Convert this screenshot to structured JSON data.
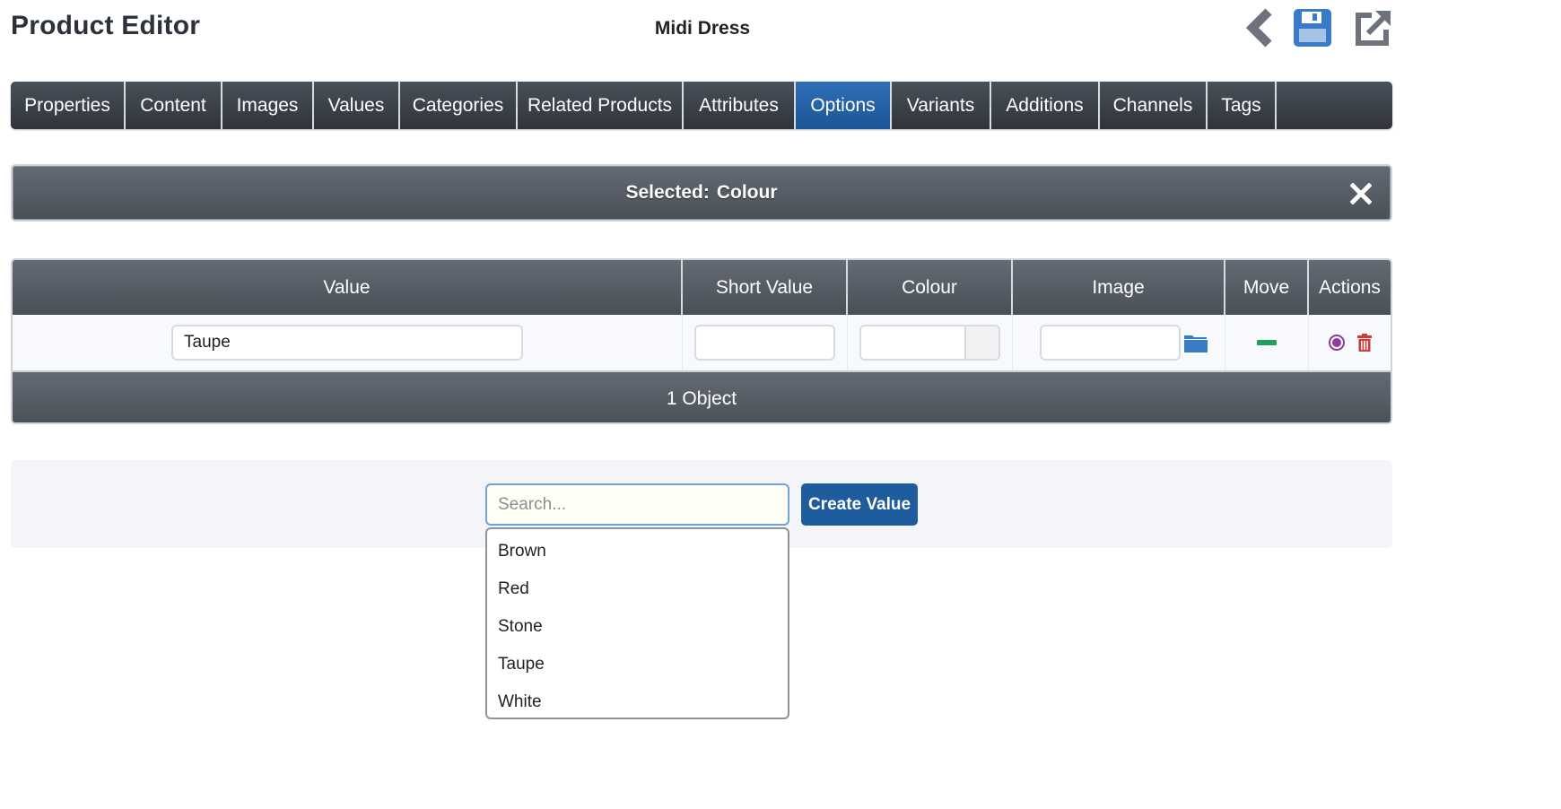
{
  "header": {
    "title": "Product Editor",
    "record_name": "Midi Dress",
    "icons": {
      "back": "chevron-left-icon",
      "save": "floppy-disk-icon",
      "external": "external-link-icon"
    }
  },
  "tabs": [
    {
      "label": "Properties",
      "active": false
    },
    {
      "label": "Content",
      "active": false
    },
    {
      "label": "Images",
      "active": false
    },
    {
      "label": "Values",
      "active": false
    },
    {
      "label": "Categories",
      "active": false
    },
    {
      "label": "Related Products",
      "active": false
    },
    {
      "label": "Attributes",
      "active": false
    },
    {
      "label": "Options",
      "active": true
    },
    {
      "label": "Variants",
      "active": false
    },
    {
      "label": "Additions",
      "active": false
    },
    {
      "label": "Channels",
      "active": false
    },
    {
      "label": "Tags",
      "active": false
    }
  ],
  "selected_bar": {
    "prefix": "Selected:",
    "value": "Colour",
    "close_icon": "close-icon"
  },
  "table": {
    "columns": [
      "Value",
      "Short Value",
      "Colour",
      "Image",
      "Move",
      "Actions"
    ],
    "rows": [
      {
        "value": "Taupe",
        "short_value": "",
        "colour": "",
        "image": ""
      }
    ],
    "footer": "1 Object"
  },
  "search": {
    "placeholder": "Search...",
    "value": "",
    "create_label": "Create Value",
    "options": [
      "Brown",
      "Red",
      "Stone",
      "Taupe",
      "White"
    ]
  },
  "colors": {
    "accent": "#1f5c9e",
    "active_tab": "#2465aa",
    "move": "#1fa05a",
    "select_action": "#8e3a9e",
    "delete_action": "#d23a3a",
    "folder": "#3a7bc8"
  }
}
